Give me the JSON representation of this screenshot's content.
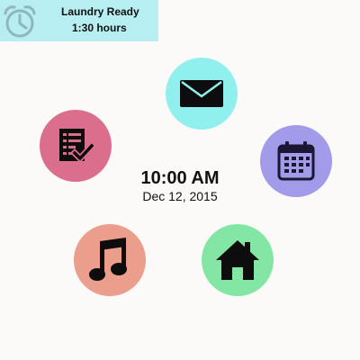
{
  "notification": {
    "title": "Laundry Ready",
    "subtitle": "1:30 hours",
    "icon": "alarm-clock-icon",
    "background": "#b6eef2"
  },
  "clock": {
    "time": "10:00 AM",
    "date": "Dec 12, 2015"
  },
  "apps": [
    {
      "name": "mail",
      "icon": "envelope-icon",
      "color": "#90f0ee"
    },
    {
      "name": "tasks",
      "icon": "checklist-icon",
      "color": "#db6e8c"
    },
    {
      "name": "calendar",
      "icon": "calendar-icon",
      "color": "#a29bea"
    },
    {
      "name": "music",
      "icon": "music-note-icon",
      "color": "#eb9e8c"
    },
    {
      "name": "home",
      "icon": "house-icon",
      "color": "#84e6a5"
    }
  ]
}
